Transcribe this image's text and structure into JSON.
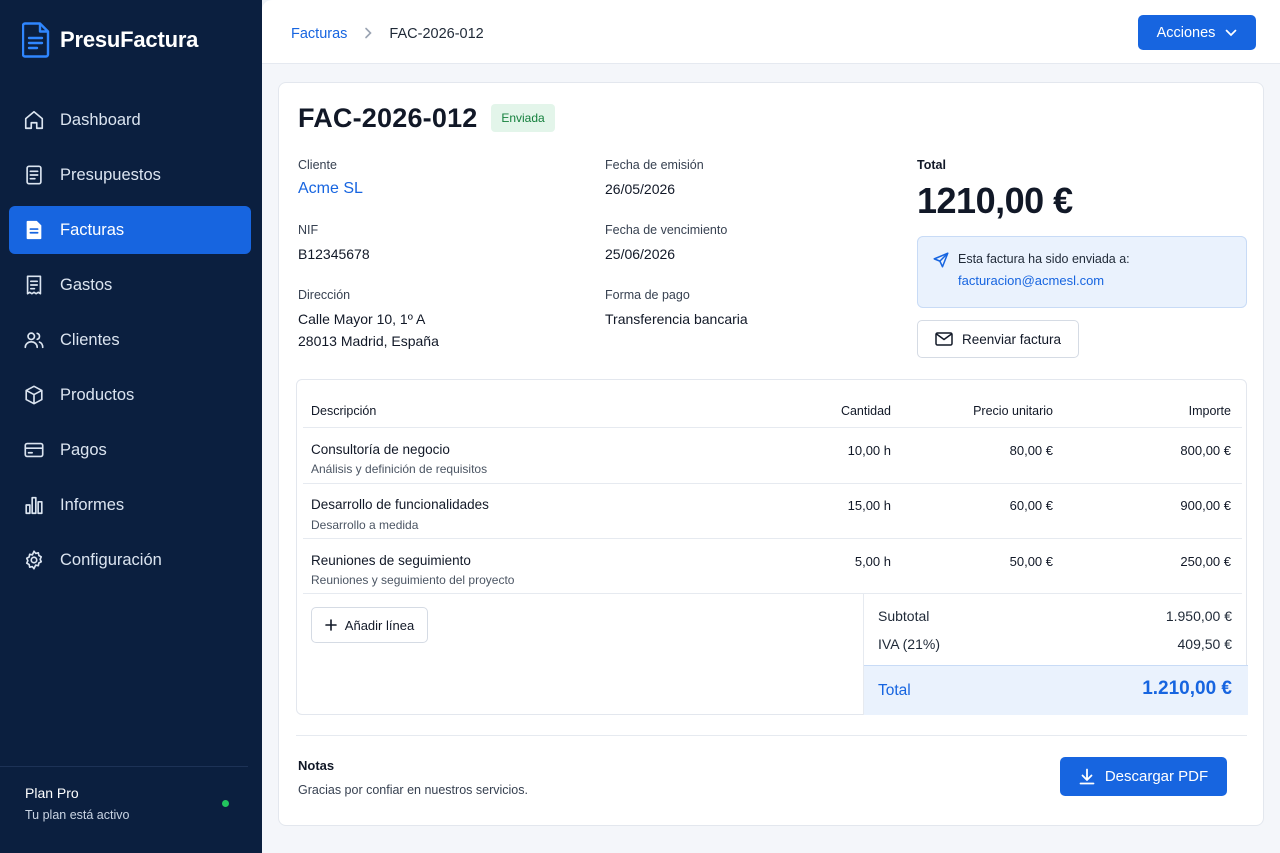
{
  "app": {
    "name": "PresuFactura"
  },
  "sidebar": {
    "items": [
      {
        "label": "Dashboard",
        "icon": "home-icon",
        "active": false
      },
      {
        "label": "Presupuestos",
        "icon": "document-list-icon",
        "active": false
      },
      {
        "label": "Facturas",
        "icon": "invoice-icon",
        "active": true
      },
      {
        "label": "Gastos",
        "icon": "receipt-icon",
        "active": false
      },
      {
        "label": "Clientes",
        "icon": "users-icon",
        "active": false
      },
      {
        "label": "Productos",
        "icon": "box-icon",
        "active": false
      },
      {
        "label": "Pagos",
        "icon": "credit-card-icon",
        "active": false
      },
      {
        "label": "Informes",
        "icon": "bar-chart-icon",
        "active": false
      },
      {
        "label": "Configuración",
        "icon": "gear-icon",
        "active": false
      }
    ],
    "plan": {
      "name": "Plan Pro",
      "status": "Tu plan está activo",
      "status_color": "#22c55e"
    }
  },
  "header": {
    "breadcrumb_parent": "Facturas",
    "breadcrumb_current": "FAC-2026-012",
    "actions_label": "Acciones"
  },
  "invoice": {
    "number": "FAC-2026-012",
    "status": "Enviada",
    "client_label": "Cliente",
    "client": "Acme SL",
    "nif_label": "NIF",
    "nif": "B12345678",
    "address_label": "Dirección",
    "address_line1": "Calle Mayor 10, 1º A",
    "address_line2": "28013 Madrid, España",
    "issue_date_label": "Fecha de emisión",
    "issue_date": "26/05/2026",
    "due_date_label": "Fecha de vencimiento",
    "due_date": "25/06/2026",
    "payment_label": "Forma de pago",
    "payment": "Transferencia bancaria",
    "total_label": "Total",
    "total": "1210,00 €",
    "sent_text": "Esta factura ha sido enviada a:",
    "sent_email": "facturacion@acmesl.com",
    "resend_label": "Reenviar factura"
  },
  "table": {
    "headers": {
      "description": "Descripción",
      "quantity": "Cantidad",
      "unit_price": "Precio unitario",
      "amount": "Importe"
    },
    "rows": [
      {
        "title": "Consultoría de negocio",
        "subtitle": "Análisis y definición de requisitos",
        "quantity": "10,00 h",
        "unit_price": "80,00 €",
        "amount": "800,00 €"
      },
      {
        "title": "Desarrollo de funcionalidades",
        "subtitle": "Desarrollo a medida",
        "quantity": "15,00 h",
        "unit_price": "60,00 €",
        "amount": "900,00 €"
      },
      {
        "title": "Reuniones de seguimiento",
        "subtitle": "Reuniones y seguimiento del proyecto",
        "quantity": "5,00 h",
        "unit_price": "50,00 €",
        "amount": "250,00 €"
      }
    ],
    "add_line_label": "Añadir línea",
    "subtotal_label": "Subtotal",
    "subtotal": "1.950,00 €",
    "tax_label": "IVA (21%)",
    "tax": "409,50 €",
    "total_label": "Total",
    "total": "1.210,00 €"
  },
  "notes": {
    "label": "Notas",
    "text": "Gracias por confiar en nuestros servicios."
  },
  "download_label": "Descargar PDF",
  "colors": {
    "sidebar_bg": "#0b1f3f",
    "accent": "#1765e0",
    "badge_bg": "#e3f5ea",
    "badge_text": "#15803d"
  }
}
